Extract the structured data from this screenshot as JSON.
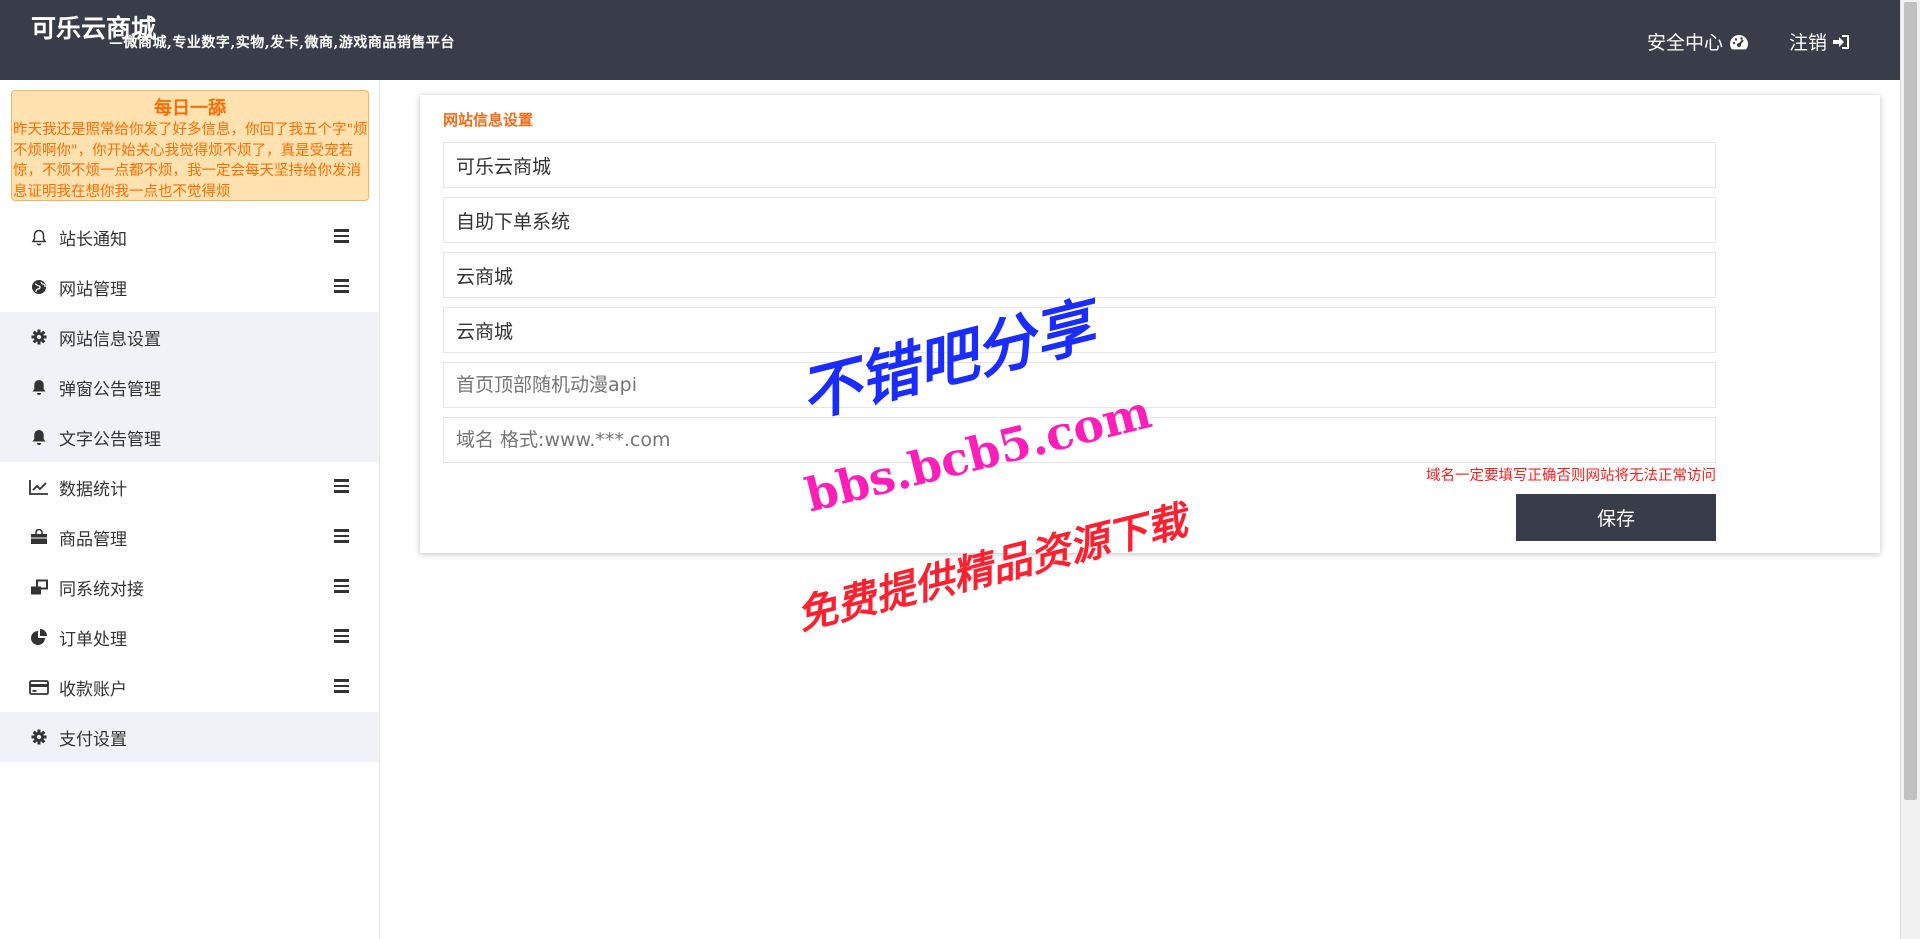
{
  "header": {
    "title": "可乐云商城",
    "subtitle": "—微商城,专业数字,实物,发卡,微商,游戏商品销售平台",
    "security_label": "安全中心",
    "logout_label": "注销"
  },
  "notice": {
    "title": "每日一舔",
    "text": "昨天我还是照常给你发了好多信息，你回了我五个字\"烦不烦啊你\"，你开始关心我觉得烦不烦了，真是受宠若惊，不烦不烦一点都不烦，我一定会每天坚持给你发消息证明我在想你我一点也不觉得烦"
  },
  "sidebar": {
    "items": [
      {
        "label": "站长通知",
        "icon": "bell-outline-icon",
        "expandable": true,
        "sub": false
      },
      {
        "label": "网站管理",
        "icon": "globe-icon",
        "expandable": true,
        "sub": false
      },
      {
        "label": "网站信息设置",
        "icon": "gear-icon",
        "expandable": false,
        "sub": true
      },
      {
        "label": "弹窗公告管理",
        "icon": "bell-icon",
        "expandable": false,
        "sub": true
      },
      {
        "label": "文字公告管理",
        "icon": "bell-icon",
        "expandable": false,
        "sub": true
      },
      {
        "label": "数据统计",
        "icon": "line-chart-icon",
        "expandable": true,
        "sub": false
      },
      {
        "label": "商品管理",
        "icon": "shopping-bag-icon",
        "expandable": true,
        "sub": false
      },
      {
        "label": "同系统对接",
        "icon": "link-windows-icon",
        "expandable": true,
        "sub": false
      },
      {
        "label": "订单处理",
        "icon": "pie-chart-icon",
        "expandable": true,
        "sub": false
      },
      {
        "label": "收款账户",
        "icon": "credit-card-icon",
        "expandable": true,
        "sub": false
      },
      {
        "label": "支付设置",
        "icon": "gear-icon",
        "expandable": false,
        "sub": true
      }
    ]
  },
  "form": {
    "title": "网站信息设置",
    "site_name_value": "可乐云商城",
    "site_desc_value": "自助下单系统",
    "keywords_value": "云商城",
    "short_name_value": "云商城",
    "anime_api_placeholder": "首页顶部随机动漫api",
    "domain_placeholder": "域名 格式:www.***.com",
    "domain_hint": "域名一定要填写正确否则网站将无法正常访问",
    "save_label": "保存"
  },
  "watermark": {
    "line1": "不错吧分享",
    "line2": "bbs.bcb5.com",
    "line3": "免费提供精品资源下载"
  }
}
